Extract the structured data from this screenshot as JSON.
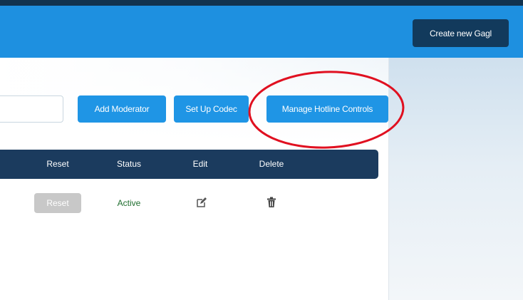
{
  "header": {
    "create_button_label": "Create new Gagl"
  },
  "toolbar": {
    "search_placeholder": "",
    "add_moderator_label": "Add Moderator",
    "set_up_codec_label": "Set Up Codec",
    "manage_hotline_label": "Manage Hotline Controls"
  },
  "table": {
    "columns": [
      "Reset",
      "Status",
      "Edit",
      "Delete"
    ],
    "rows": [
      {
        "reset_label": "Reset",
        "status": "Active",
        "edit_icon": "pencil-edit-icon",
        "delete_icon": "trash-icon"
      }
    ]
  },
  "colors": {
    "header_blue": "#1e90e0",
    "dark_navy": "#123a5c",
    "button_blue": "#1f95e5",
    "status_green": "#1f6e2f",
    "annotation_red": "#e01020"
  }
}
